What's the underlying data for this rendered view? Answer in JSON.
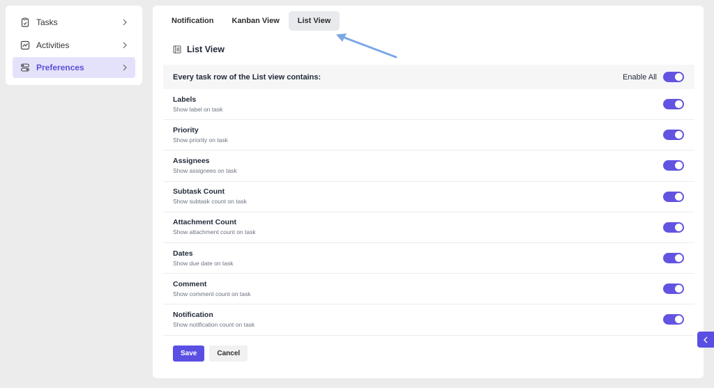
{
  "sidebar": {
    "items": [
      {
        "label": "Tasks",
        "icon": "clipboard-icon",
        "active": false
      },
      {
        "label": "Activities",
        "icon": "activity-icon",
        "active": false
      },
      {
        "label": "Preferences",
        "icon": "settings-sliders-icon",
        "active": true
      }
    ]
  },
  "tabs": [
    {
      "label": "Notification",
      "active": false
    },
    {
      "label": "Kanban View",
      "active": false
    },
    {
      "label": "List View",
      "active": true
    }
  ],
  "section": {
    "title": "List View",
    "icon": "list-icon"
  },
  "header": {
    "text": "Every task row of the List view contains:",
    "enable_all_label": "Enable All",
    "enable_all_on": true
  },
  "options": [
    {
      "title": "Labels",
      "desc": "Show label on task",
      "enabled": true
    },
    {
      "title": "Priority",
      "desc": "Show priority on task",
      "enabled": true
    },
    {
      "title": "Assignees",
      "desc": "Show assignees on task",
      "enabled": true
    },
    {
      "title": "Subtask Count",
      "desc": "Show subtask count on task",
      "enabled": true
    },
    {
      "title": "Attachment Count",
      "desc": "Show attachment count on task",
      "enabled": true
    },
    {
      "title": "Dates",
      "desc": "Show due date on task",
      "enabled": true
    },
    {
      "title": "Comment",
      "desc": "Show comment count on task",
      "enabled": true
    },
    {
      "title": "Notification",
      "desc": "Show notification count on task",
      "enabled": true
    }
  ],
  "actions": {
    "save_label": "Save",
    "cancel_label": "Cancel"
  },
  "colors": {
    "accent": "#5a4fe3",
    "active_nav_bg": "#e4e2fb",
    "annotation_arrow": "#7aa7e6"
  }
}
